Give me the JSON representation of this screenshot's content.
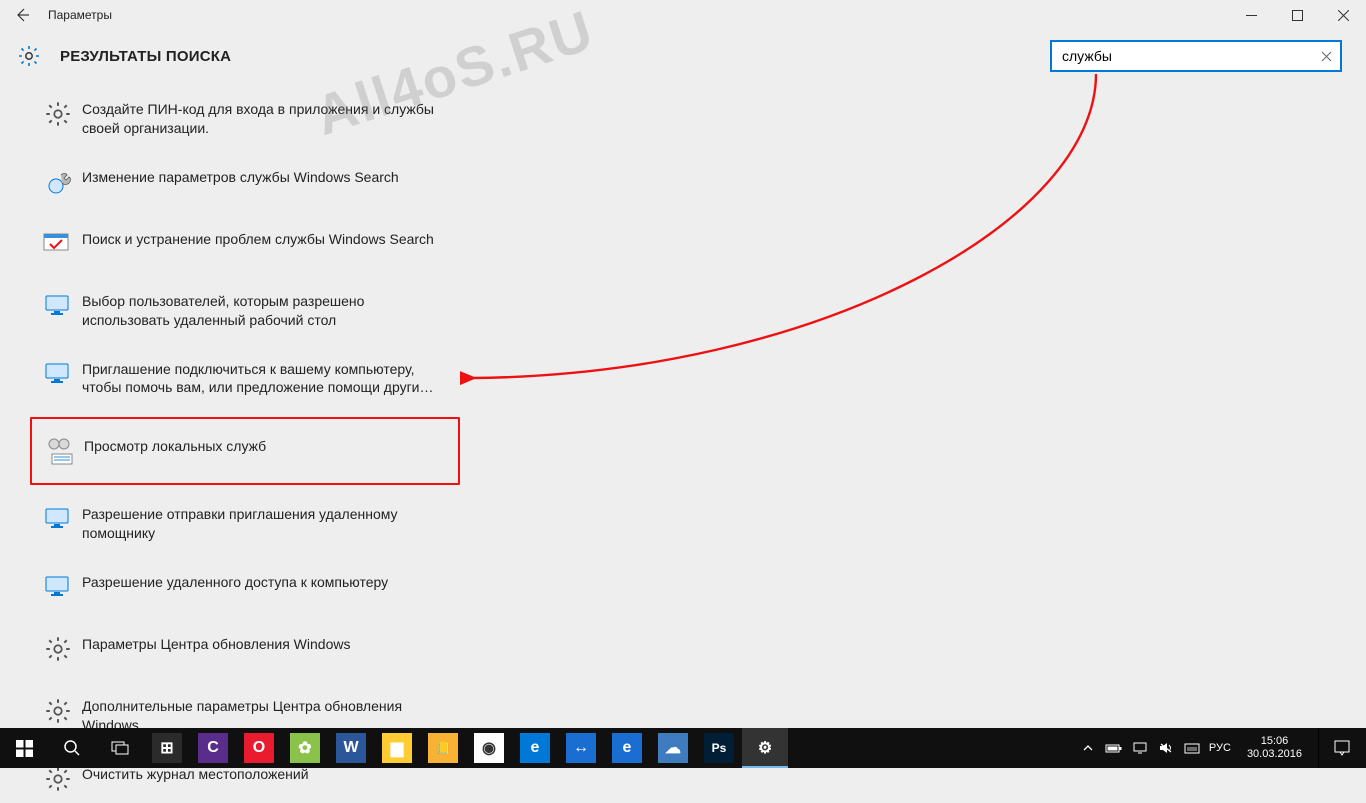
{
  "window": {
    "title": "Параметры",
    "heading": "РЕЗУЛЬТАТЫ ПОИСКА"
  },
  "search": {
    "value": "службы"
  },
  "results": [
    {
      "icon": "gear",
      "label": "Создайте ПИН-код для входа в приложения и службы своей организации."
    },
    {
      "icon": "wrench",
      "label": "Изменение параметров службы Windows Search"
    },
    {
      "icon": "troubleshoot",
      "label": "Поиск и устранение проблем службы Windows Search"
    },
    {
      "icon": "monitor",
      "label": "Выбор пользователей, которым разрешено использовать удаленный рабочий стол"
    },
    {
      "icon": "monitor",
      "label": "Приглашение подключиться к вашему компьютеру, чтобы помочь вам, или предложение помощи други…"
    },
    {
      "icon": "services",
      "label": "Просмотр локальных служб",
      "highlighted": true
    },
    {
      "icon": "monitor",
      "label": "Разрешение отправки приглашения удаленному помощнику"
    },
    {
      "icon": "monitor",
      "label": "Разрешение удаленного доступа к компьютеру"
    },
    {
      "icon": "gear",
      "label": "Параметры Центра обновления Windows"
    },
    {
      "icon": "gear",
      "label": "Дополнительные параметры Центра обновления Windows"
    },
    {
      "icon": "gear",
      "label": "Очистить журнал местоположений"
    }
  ],
  "taskbar": {
    "apps": [
      {
        "name": "calculator",
        "bg": "#2b2b2b",
        "glyph": "⊞"
      },
      {
        "name": "ccleaner",
        "bg": "#5a2d8c",
        "glyph": "C"
      },
      {
        "name": "opera",
        "bg": "#e81c2e",
        "glyph": "O"
      },
      {
        "name": "android",
        "bg": "#8bc34a",
        "glyph": "✿"
      },
      {
        "name": "word",
        "bg": "#2b579a",
        "glyph": "W"
      },
      {
        "name": "explorer",
        "bg": "#ffcc33",
        "glyph": "▆"
      },
      {
        "name": "skype",
        "bg": "#f9b233",
        "glyph": "📒"
      },
      {
        "name": "chrome",
        "bg": "#ffffff",
        "glyph": "◉"
      },
      {
        "name": "edge",
        "bg": "#0078d7",
        "glyph": "e"
      },
      {
        "name": "teamviewer",
        "bg": "#1a6dd1",
        "glyph": "↔"
      },
      {
        "name": "ie",
        "bg": "#1a6dd1",
        "glyph": "e"
      },
      {
        "name": "onedrive",
        "bg": "#3e7cbf",
        "glyph": "☁"
      },
      {
        "name": "photoshop",
        "bg": "#001e36",
        "glyph": "Ps"
      },
      {
        "name": "settings",
        "bg": "#333333",
        "glyph": "⚙",
        "active": true
      }
    ],
    "lang": "РУС",
    "time": "15:06",
    "date": "30.03.2016"
  },
  "watermark": "All4oS.RU"
}
